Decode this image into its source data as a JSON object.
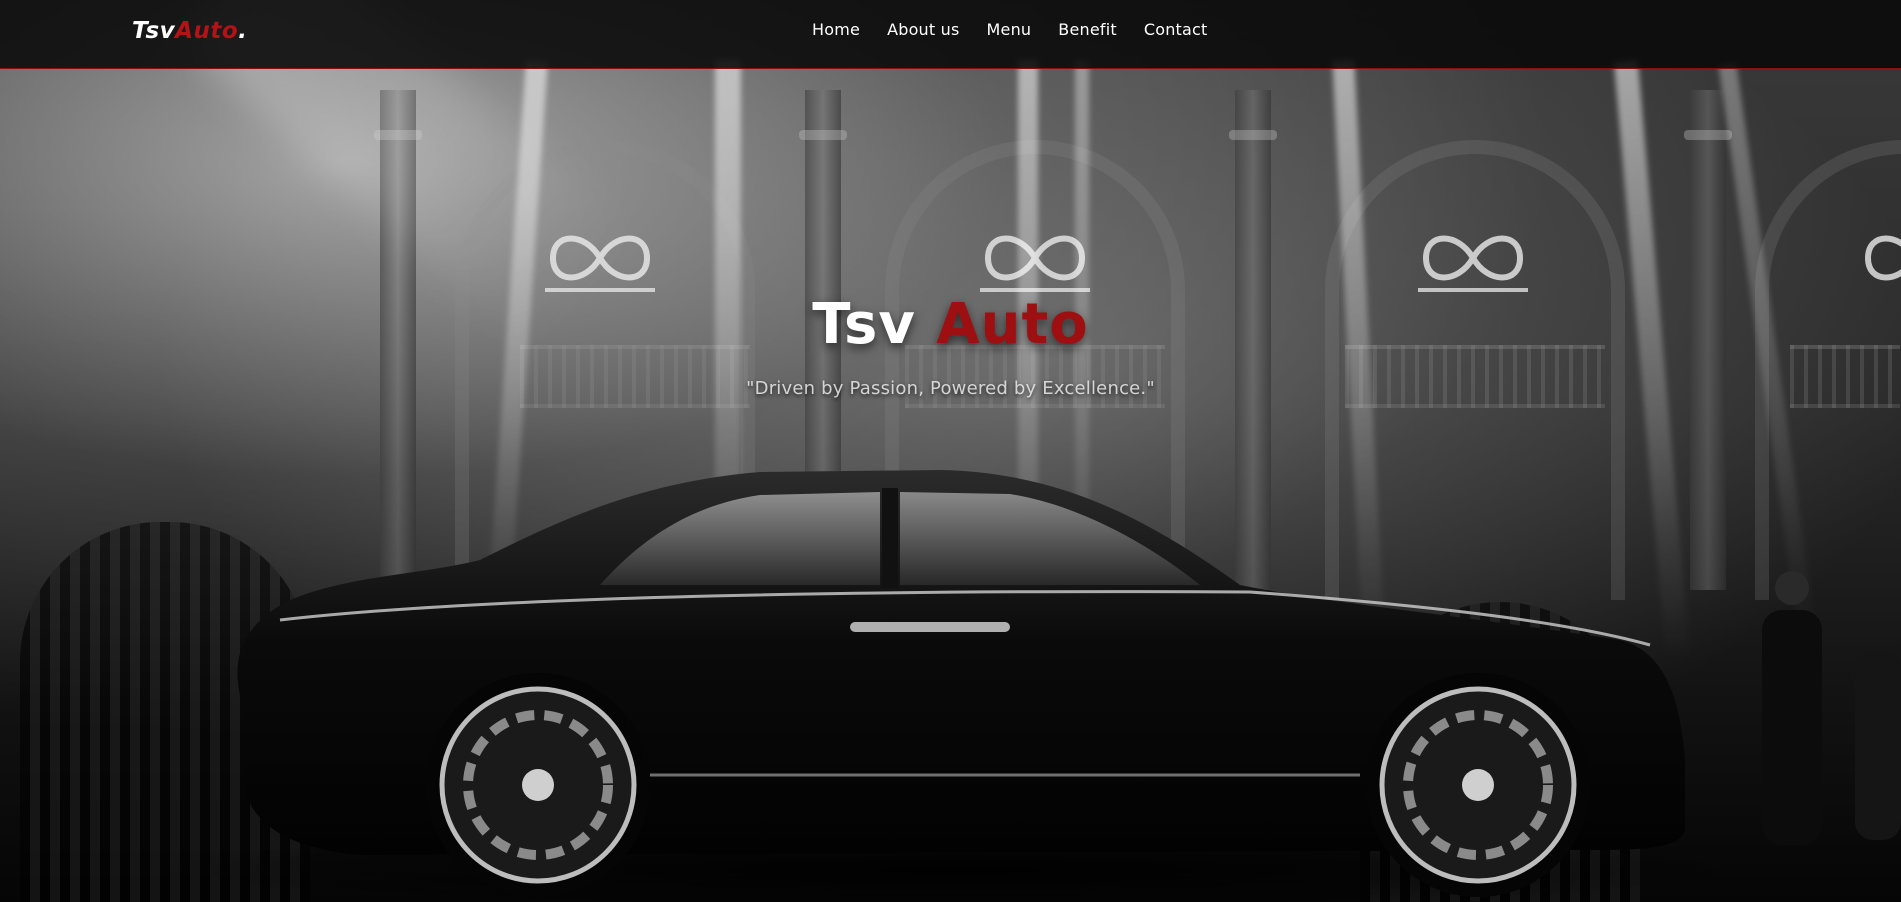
{
  "navbar": {
    "logo": {
      "part1": "Tsv",
      "part2": "Auto",
      "part3": "."
    },
    "links": [
      {
        "label": "Home"
      },
      {
        "label": "About us"
      },
      {
        "label": "Menu"
      },
      {
        "label": "Benefit"
      },
      {
        "label": "Contact"
      }
    ]
  },
  "hero": {
    "title_part1": "Tsv ",
    "title_part2": "Auto",
    "tagline": "\"Driven by Passion, Powered by Excellence.\""
  },
  "colors": {
    "accent_red": "#9e0f12",
    "logo_red": "#b31217",
    "nav_background": "#080808",
    "text": "#ffffff"
  },
  "icons": {
    "wall_emblem": "infinity-icon"
  }
}
